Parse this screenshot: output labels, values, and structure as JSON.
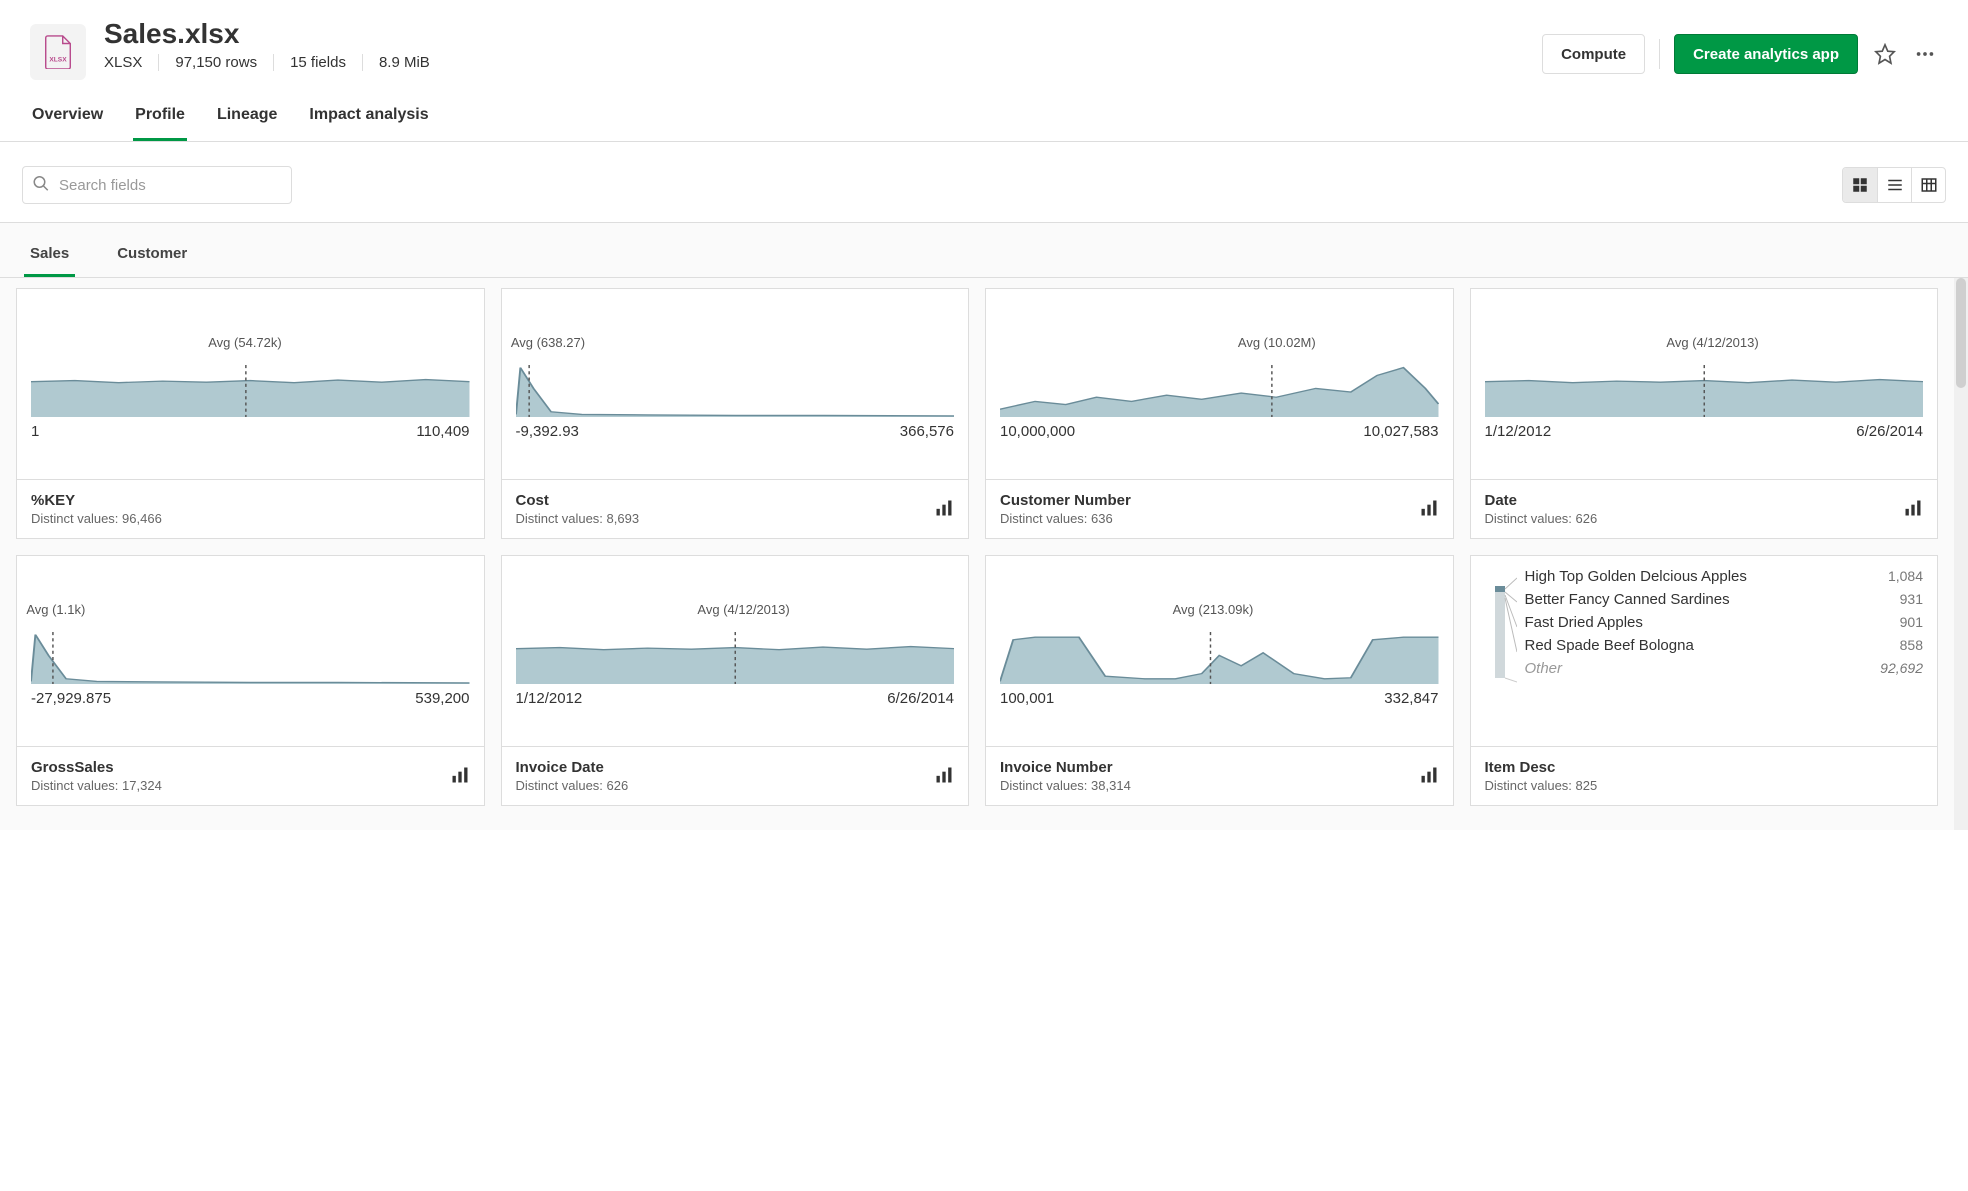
{
  "header": {
    "title": "Sales.xlsx",
    "file_type": "XLSX",
    "rows": "97,150 rows",
    "fields": "15 fields",
    "size": "8.9 MiB",
    "compute_label": "Compute",
    "create_app_label": "Create analytics app"
  },
  "main_tabs": [
    {
      "label": "Overview",
      "active": false
    },
    {
      "label": "Profile",
      "active": true
    },
    {
      "label": "Lineage",
      "active": false
    },
    {
      "label": "Impact analysis",
      "active": false
    }
  ],
  "search": {
    "placeholder": "Search fields"
  },
  "view_modes": [
    {
      "name": "grid",
      "active": true
    },
    {
      "name": "list",
      "active": false
    },
    {
      "name": "table",
      "active": false
    }
  ],
  "sub_tabs": [
    {
      "label": "Sales",
      "active": true
    },
    {
      "label": "Customer",
      "active": false
    }
  ],
  "distinct_label_prefix": "Distinct values: ",
  "other_label": "Other",
  "chart_data": [
    {
      "id": "key",
      "name": "%KEY",
      "distinct": "96,466",
      "avg_label": "Avg (54.72k)",
      "avg_pos": 0.49,
      "min": "1",
      "max": "110,409",
      "shape": "flat-wavy",
      "type_icon": false
    },
    {
      "id": "cost",
      "name": "Cost",
      "distinct": "8,693",
      "avg_label": "Avg (638.27)",
      "avg_pos": 0.03,
      "min": "-9,392.93",
      "max": "366,576",
      "shape": "spike-then-flat",
      "type_icon": true
    },
    {
      "id": "custnum",
      "name": "Customer Number",
      "distinct": "636",
      "avg_label": "Avg (10.02M)",
      "avg_pos": 0.62,
      "min": "10,000,000",
      "max": "10,027,583",
      "shape": "rising-bumpy",
      "type_icon": true
    },
    {
      "id": "date",
      "name": "Date",
      "distinct": "626",
      "avg_label": "Avg (4/12/2013)",
      "avg_pos": 0.5,
      "min": "1/12/2012",
      "max": "6/26/2014",
      "shape": "flat-wavy",
      "type_icon": true
    },
    {
      "id": "gross",
      "name": "GrossSales",
      "distinct": "17,324",
      "avg_label": "Avg (1.1k)",
      "avg_pos": 0.05,
      "min": "-27,929.875",
      "max": "539,200",
      "shape": "spike-then-flat",
      "type_icon": true
    },
    {
      "id": "invdate",
      "name": "Invoice Date",
      "distinct": "626",
      "avg_label": "Avg (4/12/2013)",
      "avg_pos": 0.5,
      "min": "1/12/2012",
      "max": "6/26/2014",
      "shape": "flat-wavy",
      "type_icon": true
    },
    {
      "id": "invnum",
      "name": "Invoice Number",
      "distinct": "38,314",
      "avg_label": "Avg (213.09k)",
      "avg_pos": 0.48,
      "min": "100,001",
      "max": "332,847",
      "shape": "hump-valley-hump",
      "type_icon": true
    },
    {
      "id": "itemdesc",
      "name": "Item Desc",
      "distinct": "825",
      "kind": "topvalues",
      "type_icon": false,
      "top_values": [
        {
          "label": "High Top Golden Delcious Apples",
          "count": "1,084"
        },
        {
          "label": "Better Fancy Canned Sardines",
          "count": "931"
        },
        {
          "label": "Fast Dried Apples",
          "count": "901"
        },
        {
          "label": "Red Spade Beef Bologna",
          "count": "858"
        }
      ],
      "other_count": "92,692"
    }
  ]
}
